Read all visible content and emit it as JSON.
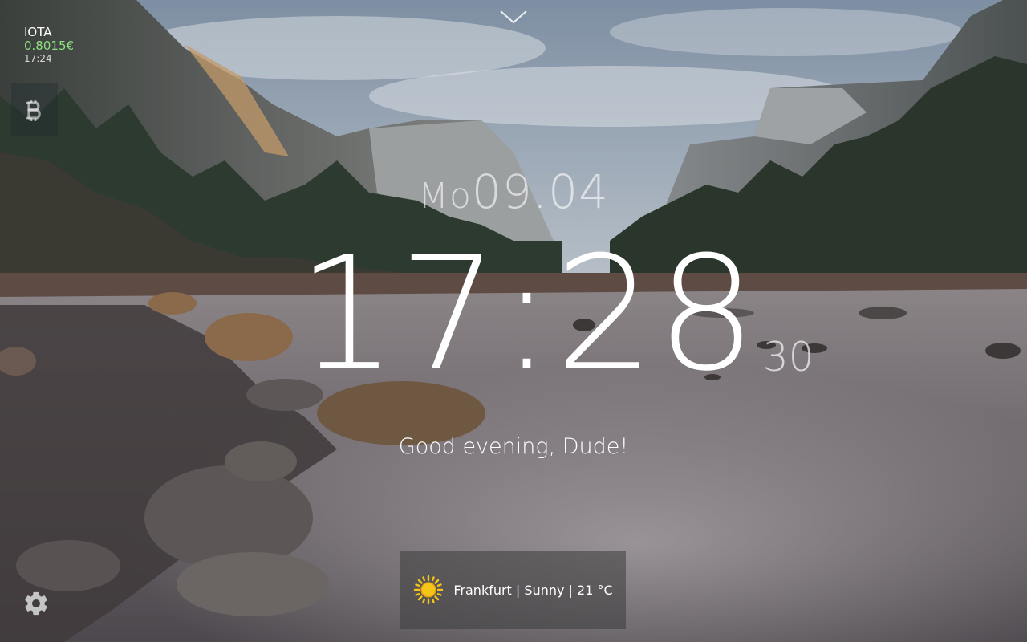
{
  "crypto": {
    "coin": "IOTA",
    "price": "0.8015€",
    "updated": "17:24",
    "icon": "bitcoin-icon"
  },
  "header": {
    "toggle_icon": "chevron-down-icon"
  },
  "date": {
    "weekday": "Mo",
    "day_month": "09.04"
  },
  "clock": {
    "hours_minutes": "17:28",
    "seconds": "30"
  },
  "greeting": "Good evening, Dude!",
  "weather": {
    "icon": "sun-icon",
    "summary": "Frankfurt | Sunny | 21 °C"
  },
  "footer": {
    "settings_icon": "gear-icon"
  },
  "colors": {
    "price_green": "#8ee07e",
    "panel_bg": "rgba(60,60,60,0.55)",
    "sun_yellow": "#f5c518"
  }
}
